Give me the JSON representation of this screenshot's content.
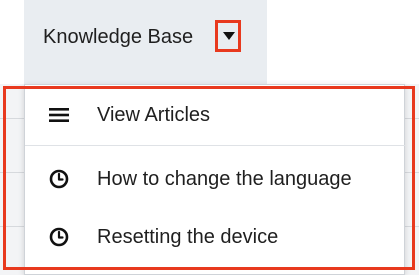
{
  "nav": {
    "tab_label": "Knowledge Base",
    "toggle_icon": "caret-down-icon"
  },
  "menu": {
    "items": [
      {
        "label": "View Articles",
        "icon": "list-icon"
      },
      {
        "label": "How to change the language",
        "icon": "clock-icon"
      },
      {
        "label": "Resetting the device",
        "icon": "clock-icon"
      }
    ]
  },
  "colors": {
    "highlight": "#e8391e",
    "tab_background": "#e9edf1",
    "text": "#1f1f1f"
  }
}
